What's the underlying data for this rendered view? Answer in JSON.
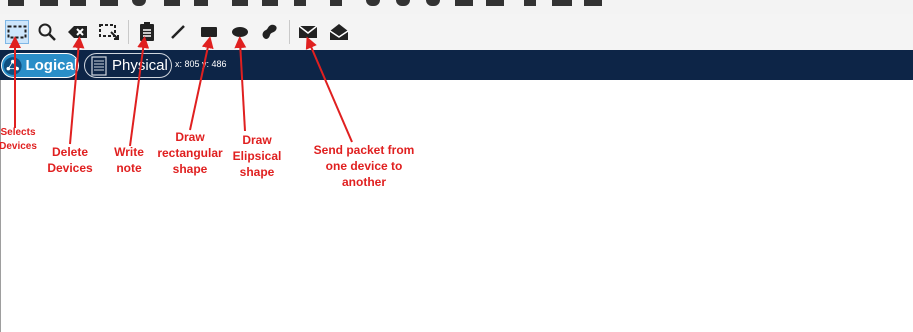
{
  "toolbar": {
    "tools": [
      {
        "name": "select-tool",
        "icon": "select-marquee-icon",
        "active": true
      },
      {
        "name": "inspect-tool",
        "icon": "magnifier-icon",
        "active": false
      },
      {
        "name": "delete-tool",
        "icon": "delete-icon",
        "active": false
      },
      {
        "name": "resize-shape-tool",
        "icon": "resize-select-icon",
        "active": false
      },
      {
        "name": "place-note-tool",
        "icon": "note-icon",
        "active": false
      },
      {
        "name": "draw-line-tool",
        "icon": "line-icon",
        "active": false
      },
      {
        "name": "draw-rectangle-tool",
        "icon": "rectangle-icon",
        "active": false
      },
      {
        "name": "draw-ellipse-tool",
        "icon": "ellipse-icon",
        "active": false
      },
      {
        "name": "freeform-tool",
        "icon": "freeform-icon",
        "active": false
      },
      {
        "name": "add-simple-pdu-tool",
        "icon": "closed-envelope-icon",
        "active": false
      },
      {
        "name": "add-complex-pdu-tool",
        "icon": "open-envelope-icon",
        "active": false
      }
    ]
  },
  "navigation": {
    "logical_label": "Logical",
    "physical_label": "Physical",
    "coordinates": "x: 805 y: 486"
  },
  "annotations": {
    "selects_devices": "Selects\nDevices",
    "delete_devices": "Delete\nDevices",
    "write_note": "Write\nnote",
    "draw_rectangular": "Draw\nrectangular\nshape",
    "draw_ellipsical": "Draw\nElipsical\nshape",
    "send_packet": "Send packet from\none device to\nanother"
  },
  "colors": {
    "nav_bar": "#0d2547",
    "logical_active": "#2a8ec8",
    "annotation": "#e02020",
    "toolbar_bg": "#f4f4f4"
  }
}
